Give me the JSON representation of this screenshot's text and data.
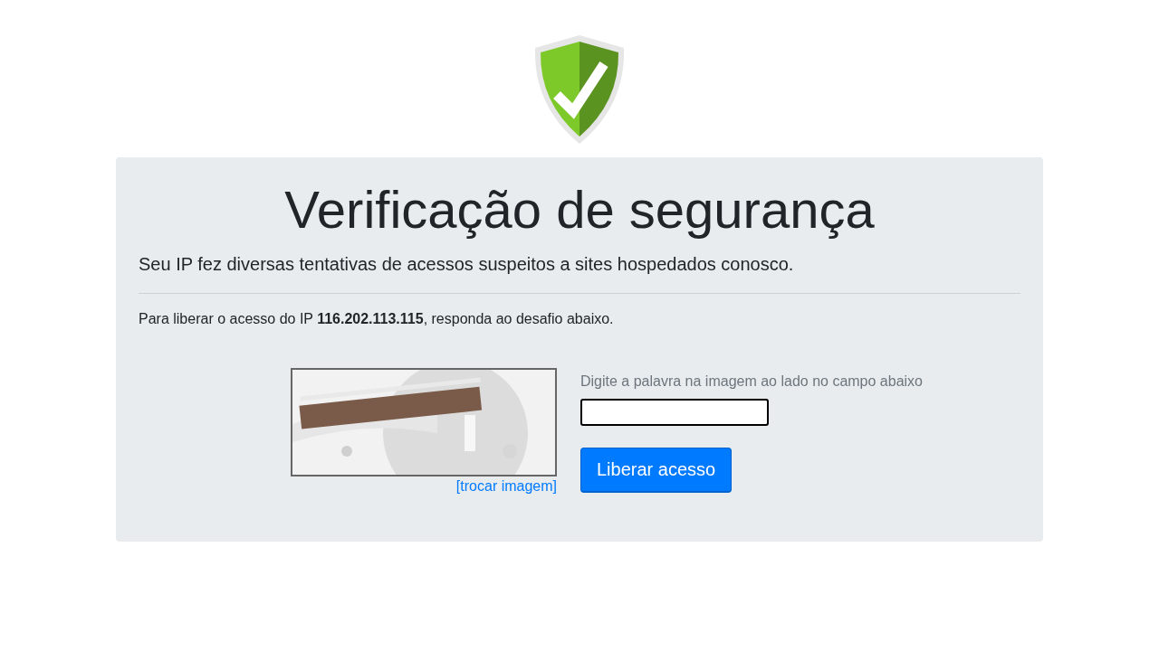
{
  "title": "Verificação de segurança",
  "subtitle": "Seu IP fez diversas tentativas de acessos suspeitos a sites hospedados conosco.",
  "instruction": "Para liberar o acesso do IP **116.202.113.115**, responda ao desafio abaixo.",
  "captcha": {
    "kind": "picture",
    "change_link": "[trocar imagem]"
  },
  "form": {
    "label": "Digite a palavra na imagem ao lado no campo abaixo",
    "submit": "Liberar acesso"
  }
}
